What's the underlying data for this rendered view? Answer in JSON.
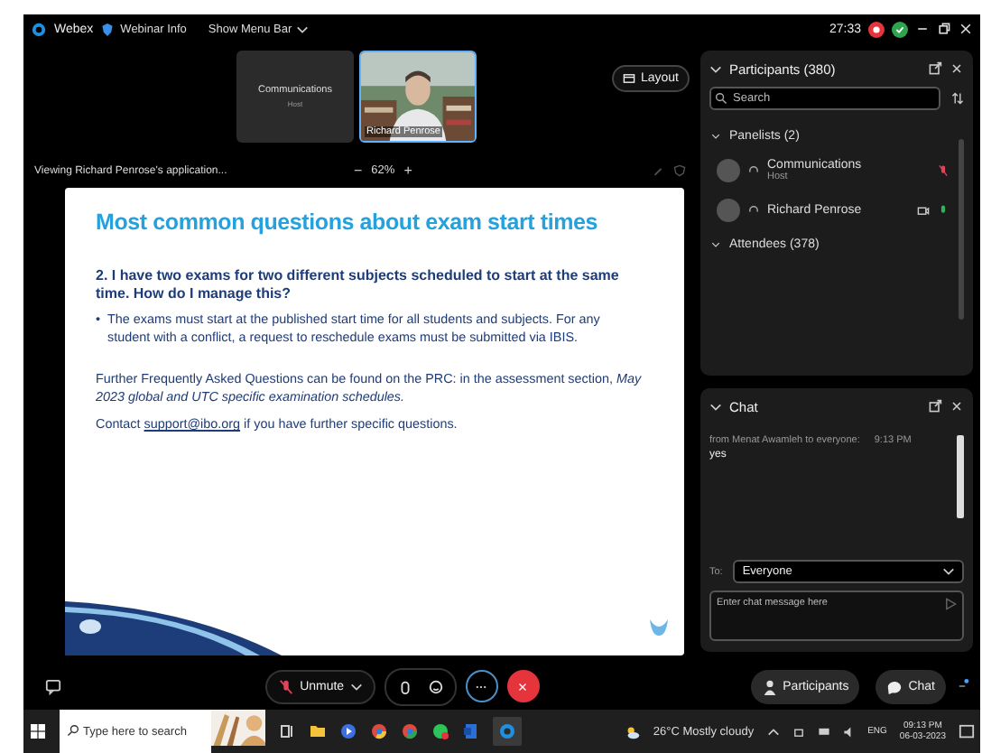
{
  "title_bar": {
    "app": "Webex",
    "menu_items": [
      "Webinar Info",
      "Show Menu Bar"
    ],
    "timer": "27:33"
  },
  "videos": [
    {
      "name": "Communications",
      "role": "Host",
      "kind": "avatar",
      "active": false
    },
    {
      "name": "Richard Penrose",
      "kind": "video",
      "active": true
    }
  ],
  "layout_button": "Layout",
  "share_bar": {
    "label": "Viewing Richard Penrose's application...",
    "zoom_out": "−",
    "zoom": "62%",
    "zoom_in": "+"
  },
  "slide": {
    "title": "Most common questions about exam start times",
    "question": "2. I have two exams for two different subjects scheduled to start at the same time. How do I manage this?",
    "bullet_mark": "•",
    "bullet": "The exams must start at the published start time for all students and subjects. For any student with a conflict, a request to reschedule exams must be submitted via IBIS.",
    "further": "Further Frequently Asked Questions can be found on the PRC: in the assessment section, *May 2023 global and UTC specific examination schedules.*",
    "contact_before": "Contact",
    "contact_link": "support@ibo.org",
    "contact_after": "if you have further specific questions."
  },
  "participants": {
    "title": "Participants (380)",
    "search_placeholder": "Search",
    "groups": [
      {
        "label": "Panelists (2)",
        "expanded": true,
        "people": [
          {
            "name": "Communications",
            "role": "Host",
            "muted": true,
            "camera": false
          },
          {
            "name": "Richard Penrose",
            "muted": false,
            "camera": true
          }
        ]
      },
      {
        "label": "Attendees (378)",
        "expanded": true
      }
    ]
  },
  "chat": {
    "title": "Chat",
    "messages": [
      {
        "sender": "from Menat Awamleh to everyone:",
        "time": "9:13 PM",
        "text": "yes"
      }
    ],
    "to_label": "To:",
    "recipient": "Everyone",
    "placeholder": "Enter chat message here"
  },
  "controls": {
    "unmute": "Unmute",
    "muted": true,
    "participants": "Participants",
    "chat": "Chat"
  },
  "taskbar": {
    "search_placeholder": "Type here to search",
    "weather": "26°C Mostly cloudy",
    "language": "ENG",
    "time": "09:13 PM",
    "date": "06-03-2023"
  }
}
